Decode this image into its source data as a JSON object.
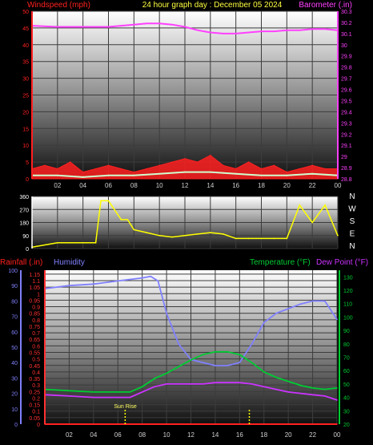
{
  "header": {
    "left_label": "Windspeed (mph)",
    "title": "24 hour graph day : December 05 2024",
    "right_label": "Barometer (.in)"
  },
  "lower_header": {
    "rainfall_label": "Rainfall (.in)",
    "humidity_label": "Humidity",
    "temperature_label": "Temperature (°F)",
    "dewpoint_label": "Dew Point (°F)"
  },
  "compass": [
    "N",
    "W",
    "S",
    "E",
    "N"
  ],
  "sunrise_label": "Sun Rise",
  "colors": {
    "wind": "#ff2020",
    "gust": "#ff0000",
    "wind_avg": "#cfffcf",
    "barometer": "#ff40ff",
    "direction": "#ffff00",
    "humidity": "#8080ff",
    "temperature": "#00cc33",
    "dewpoint": "#cc33ff",
    "rain": "#ff2020",
    "axis_left_top": "#ff2020",
    "axis_right_top": "#ff40ff",
    "axis_right_bottom": "#00cc33",
    "axis_left_bottom": "#8080ff"
  },
  "chart_data": [
    {
      "type": "line",
      "panel": "wind-barometer",
      "x_ticks": [
        "02",
        "04",
        "06",
        "08",
        "10",
        "12",
        "14",
        "16",
        "18",
        "20",
        "22",
        "00"
      ],
      "y_left_ticks": [
        "0",
        "5",
        "10",
        "15",
        "20",
        "25",
        "30",
        "35",
        "40",
        "45",
        "50"
      ],
      "y_left_lim": [
        0,
        50
      ],
      "y_right_ticks": [
        "28.8",
        "28.9",
        "29",
        "29.1",
        "29.2",
        "29.3",
        "29.4",
        "29.5",
        "29.6",
        "29.7",
        "29.8",
        "29.9",
        "30",
        "30.1",
        "30.2",
        "30.3"
      ],
      "y_right_lim": [
        28.8,
        30.3
      ],
      "series": [
        {
          "key": "barometer",
          "axis": "right",
          "x": [
            0,
            2,
            4,
            6,
            7,
            8,
            9,
            10,
            11,
            12,
            13,
            14,
            15,
            16,
            17,
            18,
            19,
            20,
            21,
            22,
            23,
            24
          ],
          "values": [
            30.17,
            30.16,
            30.16,
            30.16,
            30.17,
            30.18,
            30.19,
            30.19,
            30.18,
            30.16,
            30.13,
            30.11,
            30.1,
            30.1,
            30.11,
            30.12,
            30.12,
            30.13,
            30.13,
            30.14,
            30.14,
            30.13
          ]
        },
        {
          "key": "wind",
          "axis": "left",
          "x": [
            0,
            1,
            2,
            3,
            4,
            5,
            6,
            7,
            8,
            9,
            10,
            11,
            12,
            13,
            14,
            15,
            16,
            17,
            18,
            19,
            20,
            21,
            22,
            23,
            24
          ],
          "values": [
            3,
            4,
            3,
            5,
            2,
            3,
            4,
            3,
            2,
            3,
            4,
            5,
            6,
            5,
            7,
            4,
            3,
            5,
            3,
            4,
            2,
            3,
            4,
            3,
            3
          ]
        },
        {
          "key": "wind_avg",
          "axis": "left",
          "x": [
            0,
            2,
            4,
            6,
            8,
            10,
            12,
            14,
            16,
            18,
            20,
            22,
            24
          ],
          "values": [
            1,
            1,
            0.5,
            1,
            1,
            1.5,
            2,
            2,
            1.5,
            1,
            1,
            1.5,
            1
          ]
        }
      ]
    },
    {
      "type": "line",
      "panel": "wind-direction",
      "y_ticks": [
        "0",
        "90",
        "180",
        "270",
        "360"
      ],
      "y_lim": [
        0,
        360
      ],
      "series": [
        {
          "key": "direction",
          "x": [
            0,
            2,
            3,
            4,
            5,
            5.4,
            6,
            7,
            7.5,
            8,
            9,
            10,
            11,
            12,
            13,
            14,
            15,
            16,
            17,
            18,
            19,
            20,
            21,
            22,
            23,
            24
          ],
          "values": [
            10,
            40,
            40,
            40,
            40,
            330,
            330,
            200,
            200,
            130,
            110,
            90,
            80,
            90,
            100,
            110,
            100,
            70,
            70,
            70,
            70,
            70,
            300,
            180,
            300,
            90
          ]
        }
      ]
    },
    {
      "type": "line",
      "panel": "temperature-humidity",
      "x_ticks": [
        "02",
        "04",
        "06",
        "08",
        "10",
        "12",
        "14",
        "16",
        "18",
        "20",
        "22",
        "00"
      ],
      "y_left_ticks": [
        "0",
        "0.05",
        "0.1",
        "0.15",
        "0.2",
        "0.25",
        "0.3",
        "0.35",
        "0.4",
        "0.45",
        "0.5",
        "0.55",
        "0.6",
        "0.65",
        "0.7",
        "0.75",
        "0.8",
        "0.85",
        "0.9",
        "0.95",
        "1",
        "1.05",
        "1.1",
        "1.15"
      ],
      "y_left_lim": [
        0,
        1.18
      ],
      "y_humidity_ticks": [
        "0",
        "10",
        "20",
        "30",
        "40",
        "50",
        "60",
        "70",
        "80",
        "90",
        "100"
      ],
      "y_humidity_lim": [
        0,
        100
      ],
      "y_right_ticks": [
        "20",
        "30",
        "40",
        "50",
        "60",
        "70",
        "80",
        "90",
        "100",
        "110",
        "120",
        "130"
      ],
      "y_right_lim": [
        20,
        135
      ],
      "series": [
        {
          "key": "humidity",
          "axis": "humidity",
          "x": [
            0,
            2,
            4,
            6,
            8,
            8.7,
            9.3,
            10,
            11,
            12,
            13,
            14,
            15,
            16,
            17,
            18,
            19,
            20,
            21,
            22,
            23,
            24
          ],
          "values": [
            88,
            90,
            91,
            93,
            95,
            96,
            93,
            72,
            52,
            42,
            40,
            38,
            38,
            40,
            52,
            66,
            72,
            75,
            78,
            80,
            80,
            68
          ]
        },
        {
          "key": "temperature",
          "axis": "right",
          "x": [
            0,
            2,
            4,
            6,
            7,
            8,
            9,
            10,
            11,
            12,
            13,
            14,
            15,
            16,
            17,
            18,
            19,
            20,
            21,
            22,
            23,
            24
          ],
          "values": [
            46,
            45,
            44,
            44,
            44,
            48,
            54,
            58,
            63,
            68,
            72,
            74,
            74,
            72,
            66,
            59,
            55,
            52,
            49,
            47,
            46,
            47
          ]
        },
        {
          "key": "dewpoint",
          "axis": "right",
          "x": [
            0,
            2,
            4,
            6,
            7,
            8,
            9,
            10,
            11,
            12,
            13,
            14,
            15,
            16,
            17,
            18,
            19,
            20,
            21,
            22,
            23,
            24
          ],
          "values": [
            42,
            41,
            40,
            40,
            40,
            44,
            48,
            50,
            50,
            50,
            50,
            51,
            51,
            51,
            50,
            48,
            46,
            44,
            43,
            42,
            41,
            38
          ]
        },
        {
          "key": "rain",
          "axis": "left",
          "x": [
            0,
            24
          ],
          "values": [
            0,
            0
          ]
        }
      ],
      "markers": [
        {
          "x": 6.6,
          "label": "Sun Rise"
        },
        {
          "x": 16.8
        }
      ]
    }
  ]
}
